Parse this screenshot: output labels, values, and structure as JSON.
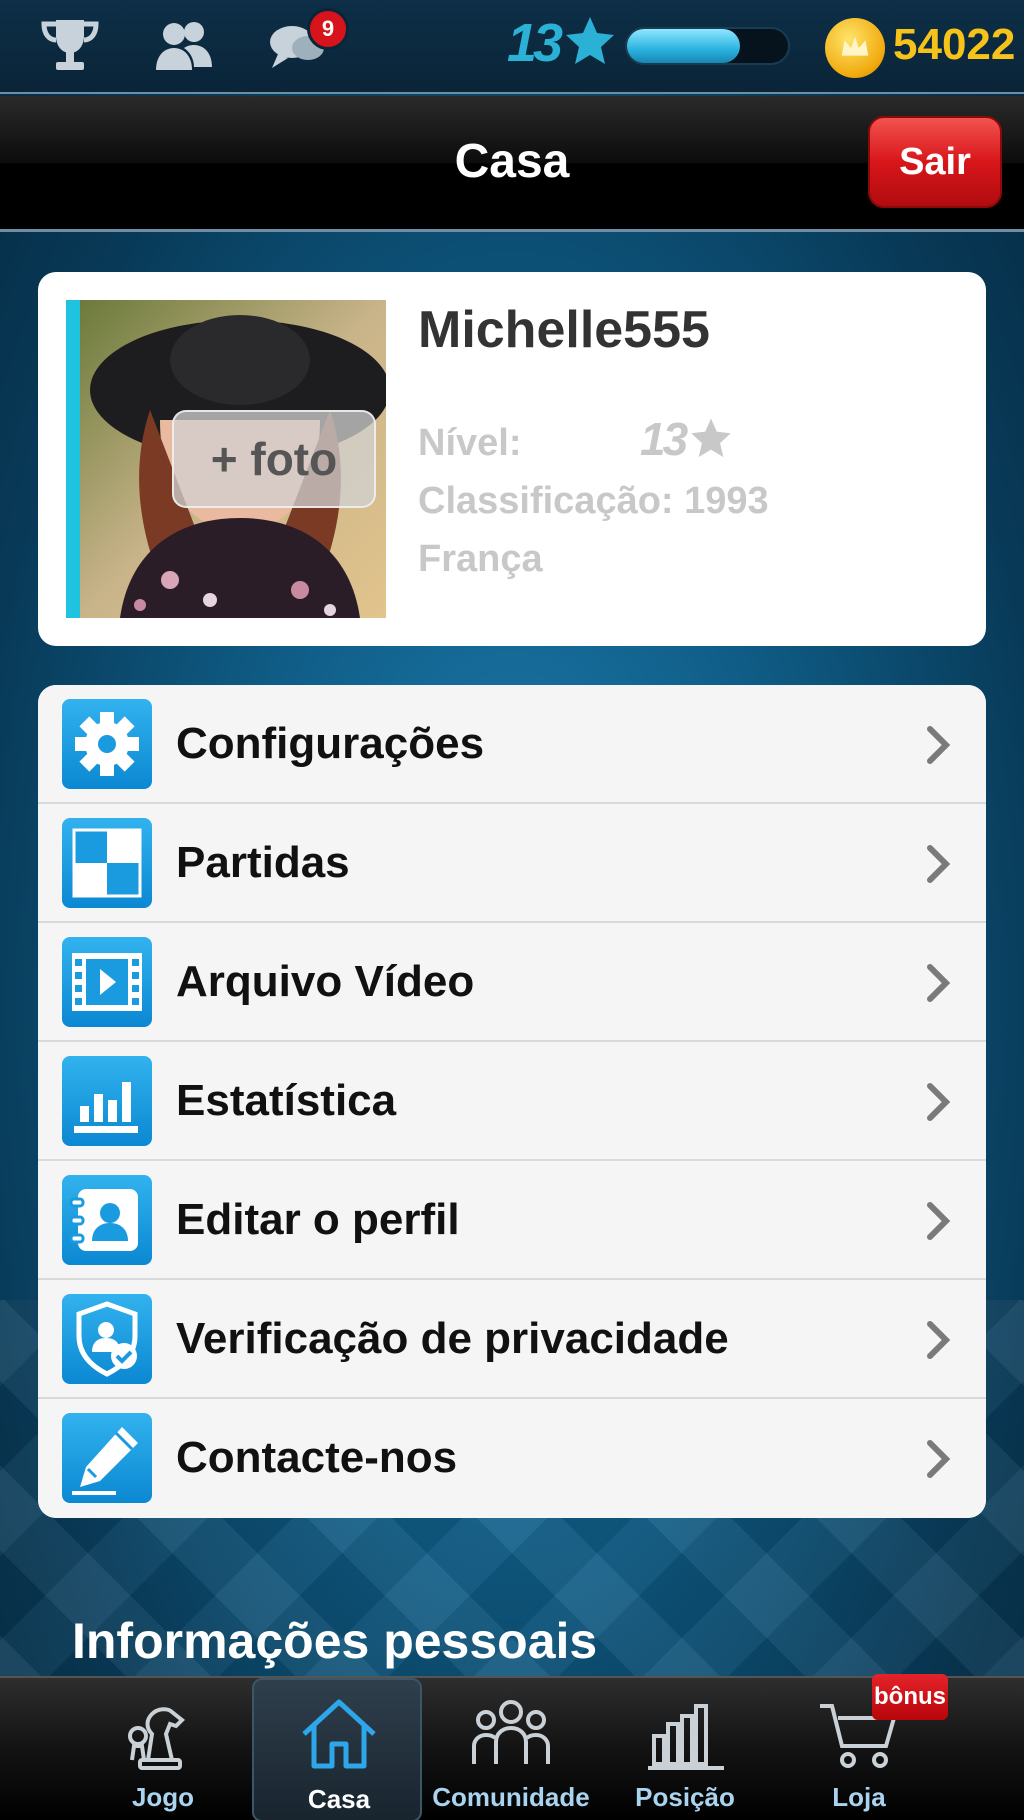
{
  "topbar": {
    "messages_badge": "9",
    "level": "13",
    "xp_progress_percent": 70,
    "coins": "54022"
  },
  "header": {
    "title": "Casa",
    "exit_button": "Sair"
  },
  "profile": {
    "username": "Michelle555",
    "add_photo": "+ foto",
    "level_label": "Nível:",
    "level_value": "13",
    "rating": "Classificação: 1993",
    "country": "França"
  },
  "menu": {
    "items": [
      {
        "label": "Configurações",
        "icon": "gear-icon"
      },
      {
        "label": "Partidas",
        "icon": "checkerboard-icon"
      },
      {
        "label": "Arquivo Vídeo",
        "icon": "film-play-icon"
      },
      {
        "label": "Estatística",
        "icon": "bar-chart-icon"
      },
      {
        "label": "Editar o perfil",
        "icon": "contact-card-icon"
      },
      {
        "label": "Verificação de privacidade",
        "icon": "privacy-shield-icon"
      },
      {
        "label": "Contacte-nos",
        "icon": "pencil-icon"
      }
    ]
  },
  "section": {
    "title": "Informações pessoais"
  },
  "bottomnav": {
    "items": [
      {
        "label": "Jogo",
        "icon": "chess-pieces-icon"
      },
      {
        "label": "Casa",
        "icon": "home-icon"
      },
      {
        "label": "Comunidade",
        "icon": "community-icon"
      },
      {
        "label": "Posição",
        "icon": "ranking-bars-icon"
      },
      {
        "label": "Loja",
        "icon": "shopping-cart-icon"
      }
    ],
    "bonus_badge": "bônus"
  },
  "colors": {
    "accent": "#1fc2df",
    "coin_text": "#f5c319",
    "exit_red": "#d8161a",
    "badge_red": "#d7141c"
  }
}
